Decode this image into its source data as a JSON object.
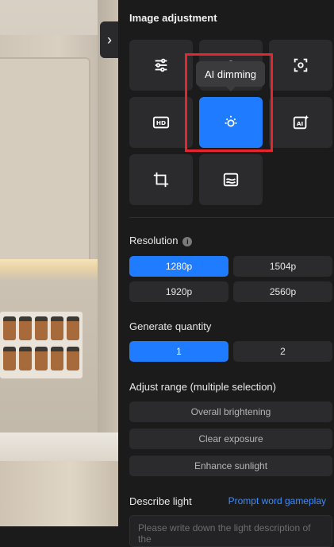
{
  "panel": {
    "title": "Image adjustment",
    "tooltip": "AI dimming",
    "tools": [
      {
        "id": "sliders",
        "icon": "sliders-icon"
      },
      {
        "id": "hidden",
        "icon": "sparkle-icon"
      },
      {
        "id": "object-ai",
        "icon": "object-ai-icon"
      },
      {
        "id": "hd",
        "icon": "hd-icon"
      },
      {
        "id": "ai-dimming",
        "icon": "ai-dimming-icon",
        "active": true
      },
      {
        "id": "ai-text",
        "icon": "ai-sparkle-icon"
      },
      {
        "id": "crop",
        "icon": "crop-icon"
      },
      {
        "id": "landscape",
        "icon": "landscape-icon"
      }
    ]
  },
  "resolution": {
    "label": "Resolution",
    "options": [
      "1280p",
      "1504p",
      "1920p",
      "2560p"
    ],
    "selected": "1280p"
  },
  "quantity": {
    "label": "Generate quantity",
    "options": [
      "1",
      "2"
    ],
    "selected": "1"
  },
  "range": {
    "label": "Adjust range (multiple selection)",
    "options": [
      "Overall brightening",
      "Clear exposure",
      "Enhance sunlight"
    ]
  },
  "describe": {
    "label": "Describe light",
    "link": "Prompt word gameplay",
    "placeholder": "Please write down the light description of the"
  },
  "colors": {
    "accent": "#1f7bff",
    "highlight": "#e5262d",
    "background": "#1b1b1c",
    "tile": "#2b2b2d"
  }
}
